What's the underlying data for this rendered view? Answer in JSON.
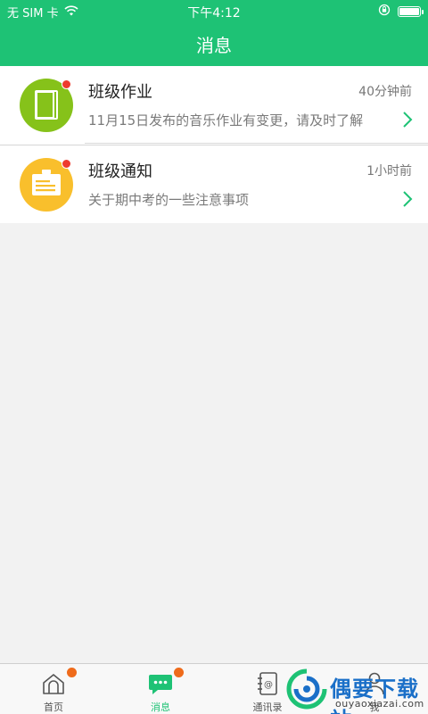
{
  "status_bar": {
    "carrier": "无 SIM 卡",
    "time": "下午4:12"
  },
  "navbar": {
    "title": "消息"
  },
  "messages": [
    {
      "title": "班级作业",
      "time": "40分钟前",
      "preview": "11月15日发布的音乐作业有变更，请及时了解",
      "icon": "notebook-icon",
      "color": "#86c21a",
      "unread": true
    },
    {
      "title": "班级通知",
      "time": "1小时前",
      "preview": "关于期中考的一些注意事项",
      "icon": "clipboard-icon",
      "color": "#f9bf2c",
      "unread": true
    }
  ],
  "tabbar": {
    "tabs": [
      {
        "label": "首页",
        "icon": "home-icon",
        "badge": true
      },
      {
        "label": "消息",
        "icon": "chat-icon",
        "badge": true,
        "active": true
      },
      {
        "label": "通讯录",
        "icon": "contacts-icon",
        "badge": false
      },
      {
        "label": "我",
        "icon": "person-icon",
        "badge": false
      }
    ]
  },
  "watermark": {
    "brand": "偶要下载站",
    "url": "ouyaoxiazai.com"
  },
  "colors": {
    "accent": "#1ec275",
    "badge_red": "#ee3b2e",
    "badge_orange": "#ef6b1b"
  }
}
